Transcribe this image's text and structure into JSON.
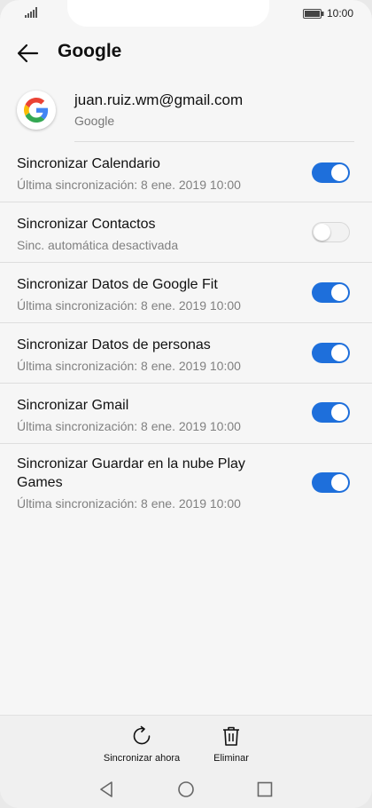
{
  "status": {
    "time": "10:00"
  },
  "header": {
    "title": "Google"
  },
  "account": {
    "email": "juan.ruiz.wm@gmail.com",
    "type": "Google"
  },
  "sync_items": [
    {
      "title": "Sincronizar Calendario",
      "subtitle": "Última sincronización: 8 ene. 2019 10:00",
      "enabled": true
    },
    {
      "title": "Sincronizar Contactos",
      "subtitle": "Sinc. automática desactivada",
      "enabled": false
    },
    {
      "title": "Sincronizar Datos de Google Fit",
      "subtitle": "Última sincronización: 8 ene. 2019 10:00",
      "enabled": true
    },
    {
      "title": "Sincronizar Datos de personas",
      "subtitle": "Última sincronización: 8 ene. 2019 10:00",
      "enabled": true
    },
    {
      "title": "Sincronizar Gmail",
      "subtitle": "Última sincronización: 8 ene. 2019 10:00",
      "enabled": true
    },
    {
      "title": "Sincronizar Guardar en la nube Play Games",
      "subtitle": "Última sincronización: 8 ene. 2019 10:00",
      "enabled": true
    }
  ],
  "actions": {
    "sync_now": "Sincronizar ahora",
    "delete": "Eliminar"
  },
  "icons": {
    "back": "arrow-left-icon",
    "refresh": "refresh-icon",
    "trash": "trash-icon",
    "nav_back": "triangle-back-icon",
    "nav_home": "circle-home-icon",
    "nav_recent": "square-recent-icon"
  },
  "colors": {
    "toggle_on": "#1e6fdb",
    "toggle_off": "#f2f2f2",
    "background": "#f6f6f6"
  }
}
